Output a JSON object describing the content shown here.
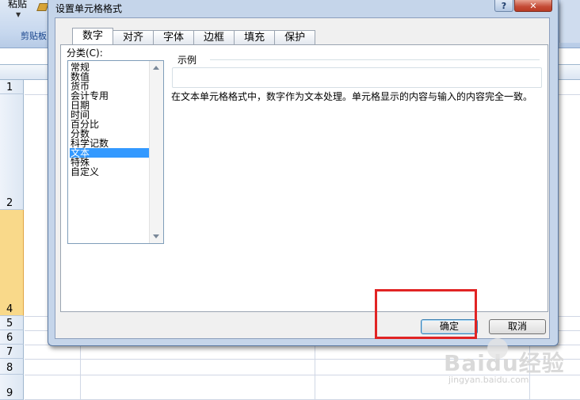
{
  "ribbon": {
    "paste_label": "粘贴",
    "clipboard_group": "剪贴板"
  },
  "dialog": {
    "title": "设置单元格格式",
    "help_label": "?",
    "close_label": "✕",
    "tabs": [
      "数字",
      "对齐",
      "字体",
      "边框",
      "填充",
      "保护"
    ],
    "active_tab": "数字",
    "category_label": "分类(C):",
    "categories": [
      "常规",
      "数值",
      "货币",
      "会计专用",
      "日期",
      "时间",
      "百分比",
      "分数",
      "科学记数",
      "文本",
      "特殊",
      "自定义"
    ],
    "selected_category": "文本",
    "sample_label": "示例",
    "description": "在文本单元格格式中，数字作为文本处理。单元格显示的内容与输入的内容完全一致。",
    "ok_label": "确定",
    "cancel_label": "取消"
  },
  "sheet": {
    "row_numbers": [
      "1",
      "2",
      "4",
      "5",
      "6",
      "7",
      "8",
      "9"
    ]
  },
  "watermark": {
    "brand": "Baidu经验",
    "url": "jingyan.baidu.com"
  },
  "colors": {
    "selection": "#3399ff",
    "highlight_box": "#e12424",
    "selected_row_header": "#f9d98a"
  }
}
